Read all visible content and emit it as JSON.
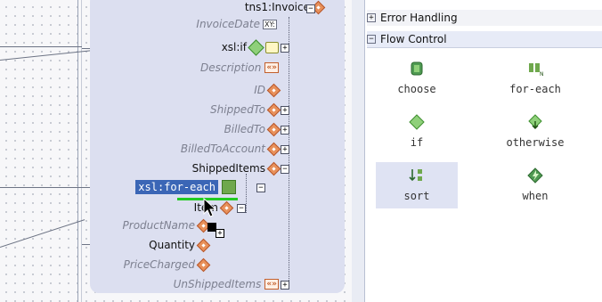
{
  "tree": {
    "rows": [
      {
        "label": "tns1:Invoice",
        "style": "bold"
      },
      {
        "label": "InvoiceDate",
        "style": "opt",
        "badge": "xsd"
      },
      {
        "label": "xsl:if",
        "style": "bold"
      },
      {
        "label": "Description",
        "style": "opt"
      },
      {
        "label": "ID",
        "style": "opt"
      },
      {
        "label": "ShippedTo",
        "style": "opt"
      },
      {
        "label": "BilledTo",
        "style": "opt"
      },
      {
        "label": "BilledToAccount",
        "style": "opt"
      },
      {
        "label": "ShippedItems",
        "style": "bold"
      },
      {
        "label": "xsl:for-each",
        "style": "highlight"
      },
      {
        "label": "Item",
        "style": "bold"
      },
      {
        "label": "ProductName",
        "style": "opt"
      },
      {
        "label": "Quantity",
        "style": "bold"
      },
      {
        "label": "PriceCharged",
        "style": "opt"
      },
      {
        "label": "UnShippedItems",
        "style": "opt"
      }
    ],
    "badges": {
      "xsd": "XY:",
      "bracket": "«»"
    }
  },
  "palette": {
    "categories": [
      {
        "label": "Error Handling",
        "state": "+"
      },
      {
        "label": "Flow Control",
        "state": "−"
      }
    ],
    "items": [
      {
        "label": "choose",
        "icon": "choose-icon"
      },
      {
        "label": "for-each",
        "icon": "for-each-icon"
      },
      {
        "label": "if",
        "icon": "if-icon"
      },
      {
        "label": "otherwise",
        "icon": "otherwise-icon"
      },
      {
        "label": "sort",
        "icon": "sort-icon",
        "selected": true
      },
      {
        "label": "when",
        "icon": "when-icon"
      }
    ]
  },
  "colors": {
    "highlight": "#3b66b6",
    "panel": "#dcdff0",
    "accent_green": "#22cc22"
  }
}
